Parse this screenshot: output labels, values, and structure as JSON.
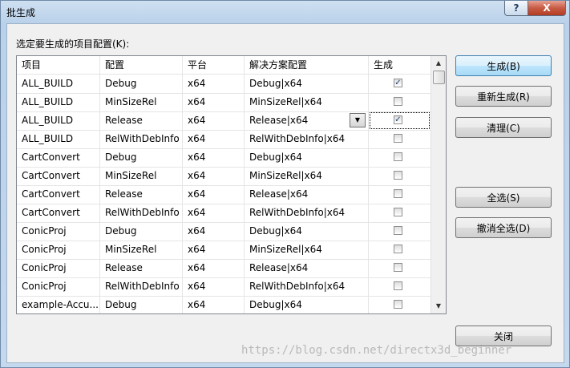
{
  "window": {
    "title": "批生成",
    "help_label": "?",
    "close_label": "X"
  },
  "prompt": "选定要生成的项目配置(K):",
  "columns": [
    "项目",
    "配置",
    "平台",
    "解决方案配置",
    "生成"
  ],
  "rows": [
    {
      "project": "ALL_BUILD",
      "config": "Debug",
      "platform": "x64",
      "solution": "Debug|x64",
      "build": true
    },
    {
      "project": "ALL_BUILD",
      "config": "MinSizeRel",
      "platform": "x64",
      "solution": "MinSizeRel|x64",
      "build": false
    },
    {
      "project": "ALL_BUILD",
      "config": "Release",
      "platform": "x64",
      "solution": "Release|x64",
      "build": true
    },
    {
      "project": "ALL_BUILD",
      "config": "RelWithDebInfo",
      "platform": "x64",
      "solution": "RelWithDebInfo|x64",
      "build": false
    },
    {
      "project": "CartConvert",
      "config": "Debug",
      "platform": "x64",
      "solution": "Debug|x64",
      "build": false
    },
    {
      "project": "CartConvert",
      "config": "MinSizeRel",
      "platform": "x64",
      "solution": "MinSizeRel|x64",
      "build": false
    },
    {
      "project": "CartConvert",
      "config": "Release",
      "platform": "x64",
      "solution": "Release|x64",
      "build": false
    },
    {
      "project": "CartConvert",
      "config": "RelWithDebInfo",
      "platform": "x64",
      "solution": "RelWithDebInfo|x64",
      "build": false
    },
    {
      "project": "ConicProj",
      "config": "Debug",
      "platform": "x64",
      "solution": "Debug|x64",
      "build": false
    },
    {
      "project": "ConicProj",
      "config": "MinSizeRel",
      "platform": "x64",
      "solution": "MinSizeRel|x64",
      "build": false
    },
    {
      "project": "ConicProj",
      "config": "Release",
      "platform": "x64",
      "solution": "Release|x64",
      "build": false
    },
    {
      "project": "ConicProj",
      "config": "RelWithDebInfo",
      "platform": "x64",
      "solution": "RelWithDebInfo|x64",
      "build": false
    },
    {
      "project": "example-Accu...",
      "config": "Debug",
      "platform": "x64",
      "solution": "Debug|x64",
      "build": false
    }
  ],
  "buttons": {
    "build": "生成(B)",
    "rebuild": "重新生成(R)",
    "clean": "清理(C)",
    "select_all": "全选(S)",
    "deselect_all": "撤消全选(D)",
    "close": "关闭"
  },
  "watermark": "https://blog.csdn.net/directx3d_beginner"
}
